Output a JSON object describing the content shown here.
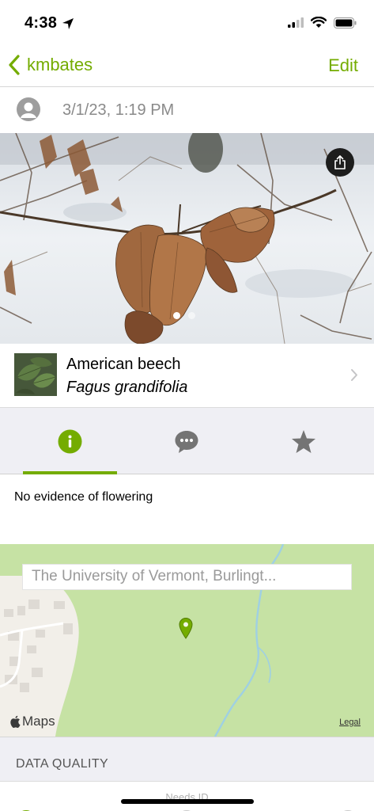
{
  "status_bar": {
    "time": "4:38"
  },
  "nav": {
    "back_label": "kmbates",
    "edit_label": "Edit"
  },
  "observation": {
    "date": "3/1/23, 1:19 PM"
  },
  "taxon": {
    "common_name": "American beech",
    "scientific_name": "Fagus grandifolia"
  },
  "photo_pager": {
    "count": 2,
    "active_index": 0
  },
  "tabs": [
    {
      "name": "info",
      "icon": "info-icon",
      "selected": true
    },
    {
      "name": "activity",
      "icon": "comment-bubble-icon",
      "selected": false
    },
    {
      "name": "favorites",
      "icon": "star-icon",
      "selected": false
    }
  ],
  "info": {
    "annotation": "No evidence of flowering"
  },
  "map": {
    "place_name": "The University of Vermont, Burlingt...",
    "provider": "Maps",
    "legal": "Legal"
  },
  "data_quality": {
    "heading": "DATA QUALITY",
    "grade": "Needs ID"
  },
  "colors": {
    "accent": "#74ac00",
    "map_green": "#c6e2a4",
    "tab_bg": "#efeff4"
  }
}
